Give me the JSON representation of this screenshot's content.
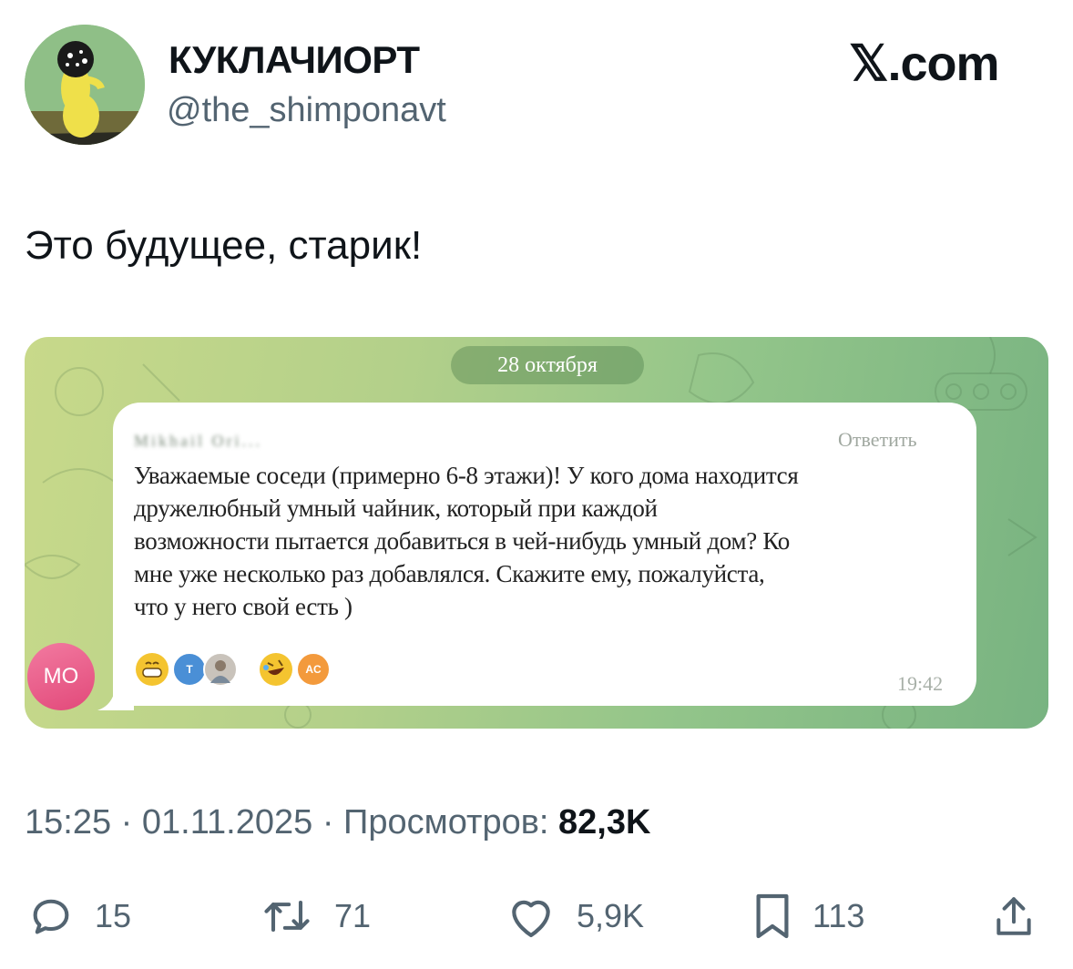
{
  "author": {
    "display_name": "КУКЛАЧИОРТ",
    "handle": "@the_shimponavt"
  },
  "brand": "𝕏.com",
  "tweet_text": "Это будущее, старик!",
  "embedded_chat": {
    "date_pill": "28 октября",
    "sender_obscured": "Mikhail Ori...",
    "reply_label": "Ответить",
    "message_lines": [
      "Уважаемые соседи (примерно 6-8 этажи)! У кого дома находится",
      "дружелюбный умный чайник, который при каждой",
      "возможности пытается добавиться в чей-нибудь умный дом? Ко",
      "мне уже несколько раз добавлялся. Скажите ему, пожалуйста,",
      "что у него свой есть )"
    ],
    "time": "19:42",
    "reactions": [
      {
        "icon": "grinning-face-icon",
        "avatars": [
          "T",
          "photo"
        ]
      },
      {
        "icon": "rofl-face-icon",
        "avatars": [
          "AC"
        ]
      }
    ],
    "left_avatar_initials": "МО",
    "colors": {
      "left_avatar": "#e2497a",
      "avatar_t": "#4a8fd6",
      "avatar_ac": "#f39a3c"
    }
  },
  "meta": {
    "time": "15:25",
    "date": "01.11.2025",
    "views_label": "Просмотров:",
    "views_value": "82,3K"
  },
  "actions": {
    "replies": "15",
    "reposts": "71",
    "likes": "5,9K",
    "bookmarks": "113"
  }
}
